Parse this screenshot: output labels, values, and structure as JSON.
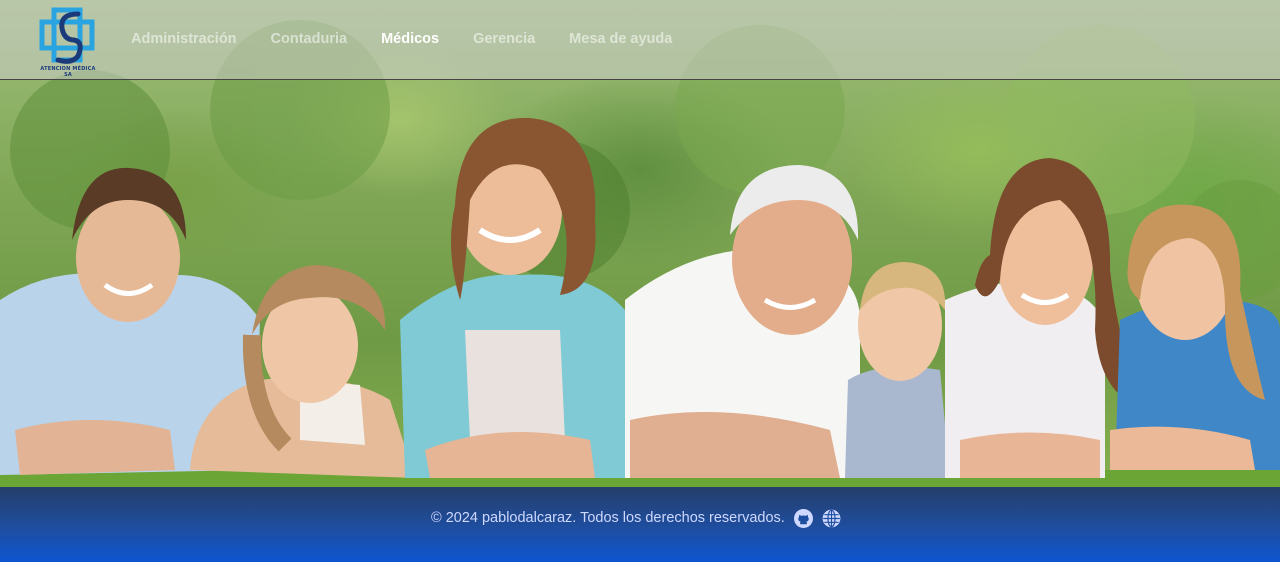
{
  "brand": {
    "logo_icon": "medical-cross-logo",
    "caption": "ATENCION MÉDICA SA",
    "colors": {
      "primary": "#1b3a7a",
      "accent": "#2aa4e0"
    }
  },
  "nav": {
    "items": [
      {
        "label": "Administración",
        "active": false
      },
      {
        "label": "Contaduria",
        "active": false
      },
      {
        "label": "Médicos",
        "active": true
      },
      {
        "label": "Gerencia",
        "active": false
      },
      {
        "label": "Mesa de ayuda",
        "active": false
      }
    ]
  },
  "hero": {
    "image_icon": "family-photo-image"
  },
  "footer": {
    "text": "© 2024 pablodalcaraz. Todos los derechos reservados.",
    "icons": [
      {
        "name": "github-icon"
      },
      {
        "name": "globe-icon"
      }
    ],
    "colors": {
      "text": "#cfd8ff",
      "bg_top": "#253e6b",
      "bg_bottom": "#0d55d0"
    }
  }
}
